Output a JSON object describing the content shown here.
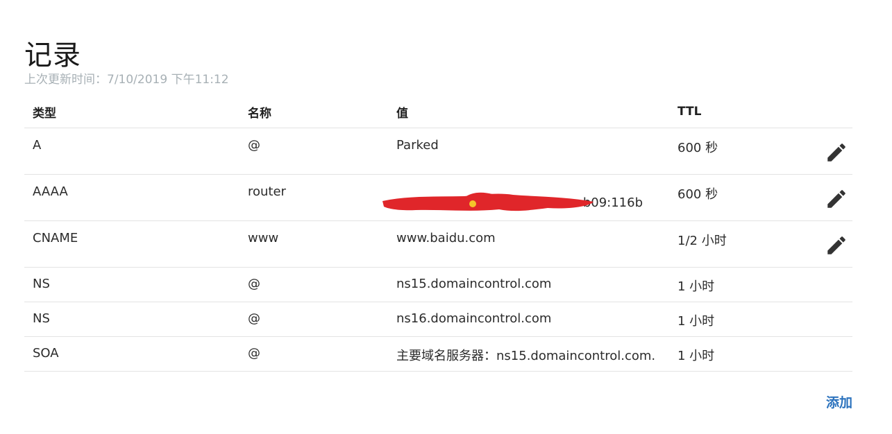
{
  "page": {
    "title": "记录",
    "last_updated": "上次更新时间：7/10/2019 下午11:12"
  },
  "table": {
    "headers": {
      "type": "类型",
      "name": "名称",
      "value": "值",
      "ttl": "TTL"
    },
    "rows": [
      {
        "type": "A",
        "name": "@",
        "value": "Parked",
        "ttl": "600 秒",
        "editable": true
      },
      {
        "type": "AAAA",
        "name": "router",
        "value": "b09:116b",
        "ttl": "600 秒",
        "editable": true,
        "redacted": true
      },
      {
        "type": "CNAME",
        "name": "www",
        "value": "www.baidu.com",
        "ttl": "1/2 小时",
        "editable": true
      },
      {
        "type": "NS",
        "name": "@",
        "value": "ns15.domaincontrol.com",
        "ttl": "1 小时",
        "editable": false
      },
      {
        "type": "NS",
        "name": "@",
        "value": "ns16.domaincontrol.com",
        "ttl": "1 小时",
        "editable": false
      },
      {
        "type": "SOA",
        "name": "@",
        "value": "主要域名服务器：ns15.domaincontrol.com.",
        "ttl": "1 小时",
        "editable": false
      }
    ]
  },
  "actions": {
    "add_label": "添加"
  },
  "icons": {
    "edit": "pencil-icon"
  },
  "colors": {
    "link": "#2b72bd",
    "muted_text": "#a7b0b5",
    "redaction": "#e0262a",
    "icon": "#333333"
  }
}
